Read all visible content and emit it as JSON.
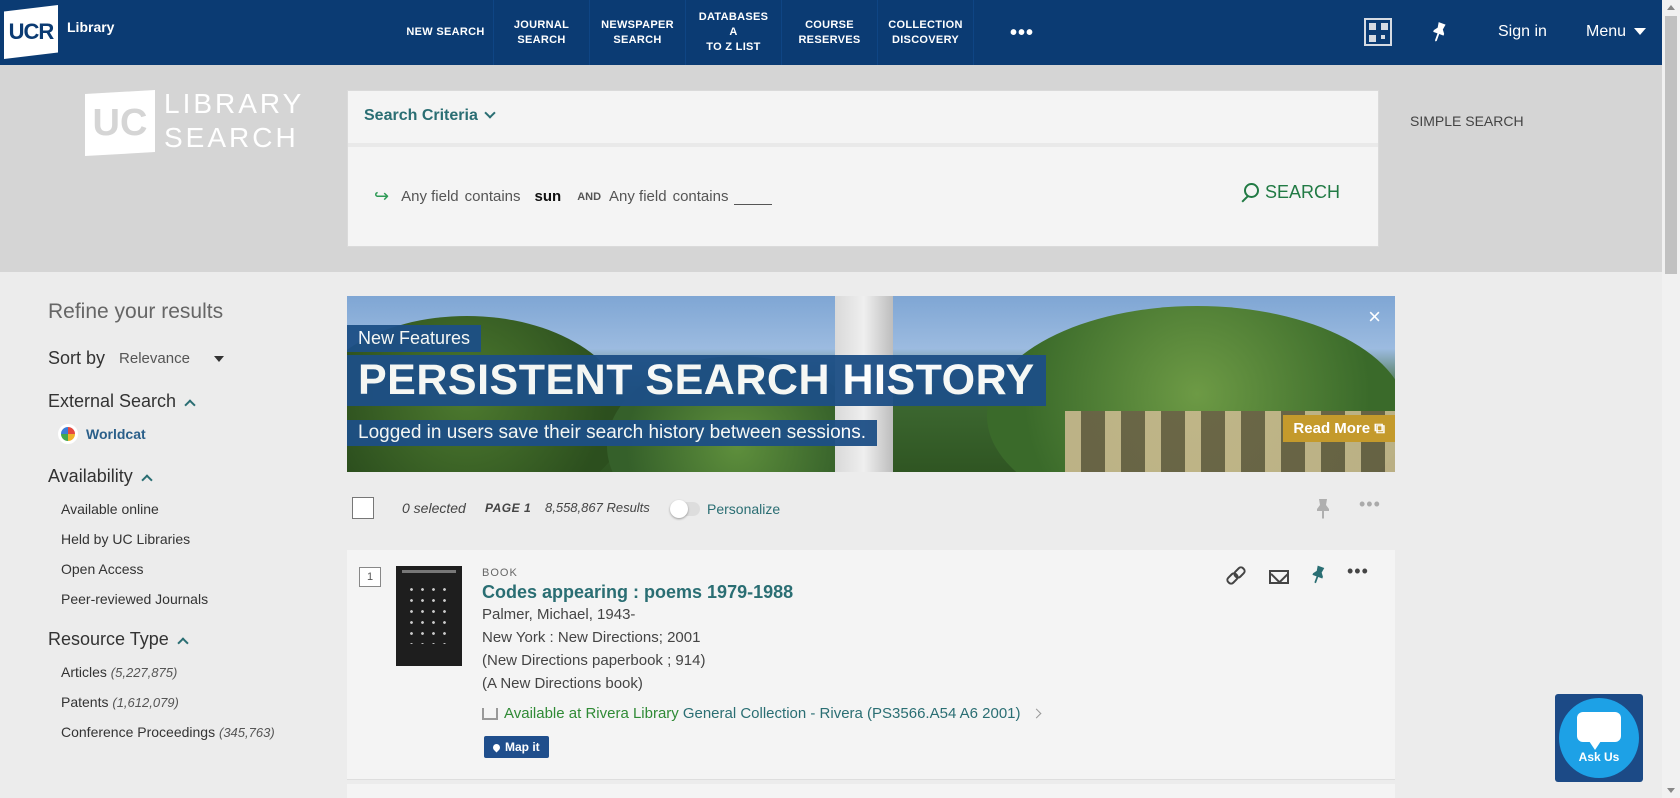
{
  "header": {
    "logo_text": "UCR",
    "library_label": "Library",
    "nav": [
      {
        "line1": "NEW SEARCH",
        "line2": ""
      },
      {
        "line1": "JOURNAL",
        "line2": "SEARCH"
      },
      {
        "line1": "NEWSPAPER",
        "line2": "SEARCH"
      },
      {
        "line1": "DATABASES A",
        "line2": "TO Z LIST"
      },
      {
        "line1": "COURSE",
        "line2": "RESERVES"
      },
      {
        "line1": "COLLECTION",
        "line2": "DISCOVERY"
      }
    ],
    "more": "•••",
    "sign_in": "Sign in",
    "menu": "Menu"
  },
  "search": {
    "logo_uc": "UC",
    "logo_line1": "LIBRARY",
    "logo_line2": "SEARCH",
    "criteria_label": "Search Criteria",
    "field1": "Any field",
    "contains1": "contains",
    "term1": "sun",
    "operator": "AND",
    "field2": "Any field",
    "contains2": "contains",
    "search_button": "SEARCH",
    "simple_search": "SIMPLE SEARCH"
  },
  "sidebar": {
    "title": "Refine your results",
    "sort_label": "Sort by",
    "sort_value": "Relevance",
    "external_search": "External Search",
    "worldcat": "Worldcat",
    "availability": "Availability",
    "availability_items": [
      "Available online",
      "Held by UC Libraries",
      "Open Access",
      "Peer-reviewed Journals"
    ],
    "resource_type": "Resource Type",
    "resource_items": [
      {
        "label": "Articles",
        "count": "(5,227,875)"
      },
      {
        "label": "Patents",
        "count": "(1,612,079)"
      },
      {
        "label": "Conference Proceedings",
        "count": "(345,763)"
      }
    ]
  },
  "banner": {
    "kicker": "New Features",
    "headline": "PERSISTENT SEARCH HISTORY",
    "subtext": "Logged in users save their search history between sessions.",
    "read_more": "Read More",
    "close": "×"
  },
  "toolbar": {
    "selected": "0 selected",
    "page": "PAGE 1",
    "results": "8,558,867 Results",
    "personalize": "Personalize",
    "more": "•••"
  },
  "result": {
    "number": "1",
    "type": "BOOK",
    "title": "Codes appearing : poems 1979-1988",
    "author": "Palmer, Michael, 1943-",
    "publisher": "New York : New Directions; 2001",
    "series1": "(New Directions paperbook ; 914)",
    "series2": "(A New Directions book)",
    "available_at": "Available at Rivera Library",
    "location": "General Collection - Rivera (PS3566.A54 A6 2001)",
    "map_it": "Map it",
    "more": "•••"
  },
  "chat": {
    "label": "Ask Us"
  },
  "colors": {
    "nav_bg": "#0b3b73",
    "accent": "#2a6e73",
    "available": "#2f8a35",
    "banner_label": "#1d4f86",
    "read_more": "#c49a2c"
  }
}
